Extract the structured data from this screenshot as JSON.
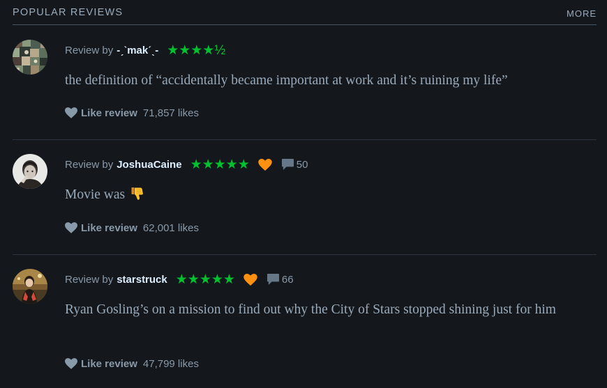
{
  "header": {
    "title": "POPULAR REVIEWS",
    "more_label": "MORE"
  },
  "colors": {
    "background": "#14181c",
    "star_green": "#00c030",
    "heart_orange": "#ff9010",
    "muted_text": "#99aabb",
    "username": "#ddeeff"
  },
  "reviews": [
    {
      "prefix": "Review by",
      "username": "-ˏˋmakˊˎ-",
      "rating_stars": "★★★★½",
      "rating_value": 4.5,
      "liked": false,
      "comments": "",
      "body": "the definition of “accidentally became important at work and it’s ruining my life”",
      "body_emoji": "",
      "like_label": "Like review",
      "likes": "71,857 likes",
      "avatar_icon": "collage-avatar"
    },
    {
      "prefix": "Review by",
      "username": "JoshuaCaine",
      "rating_stars": "★★★★★",
      "rating_value": 5,
      "liked": true,
      "comments": "50",
      "body": "Movie was",
      "body_emoji": "thumbs-down-emoji",
      "like_label": "Like review",
      "likes": "62,001 likes",
      "avatar_icon": "person-avatar"
    },
    {
      "prefix": "Review by",
      "username": "starstruck",
      "rating_stars": "★★★★★",
      "rating_value": 5,
      "liked": true,
      "comments": "66",
      "body": "Ryan Gosling’s on a mission to find out why the City of Stars stopped shining just for him",
      "body_emoji": "",
      "like_label": "Like review",
      "likes": "47,799 likes",
      "avatar_icon": "person-avatar"
    }
  ]
}
